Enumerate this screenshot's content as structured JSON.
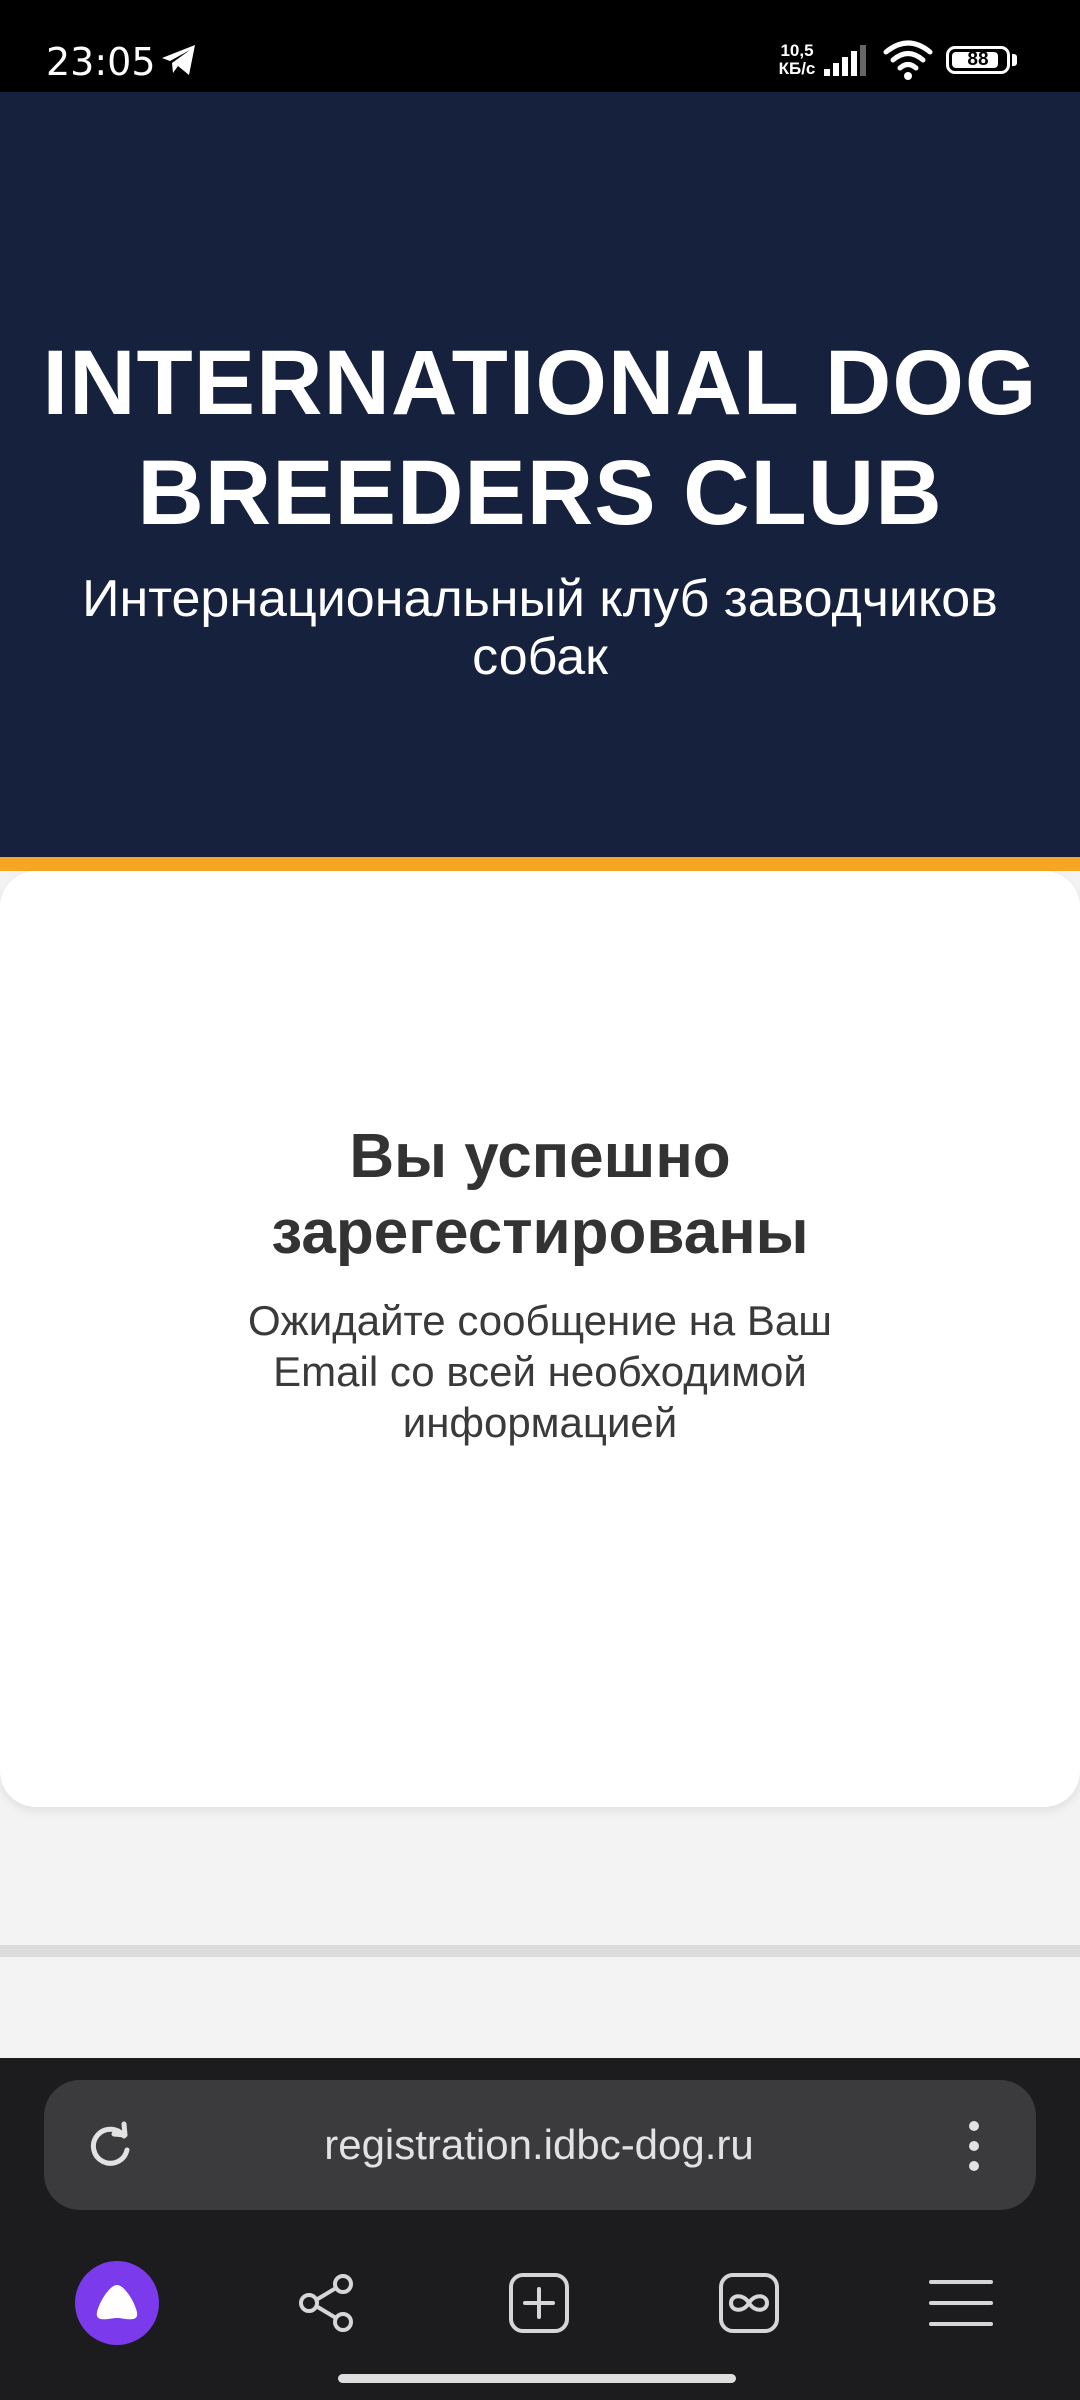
{
  "status_bar": {
    "time": "23:05",
    "net_speed_value": "10,5",
    "net_speed_unit": "КБ/с",
    "battery_level": "88",
    "icons": [
      "telegram-icon",
      "signal-icon",
      "wifi-icon",
      "battery-icon"
    ]
  },
  "hero": {
    "title": "INTERNATIONAL DOG BREEDERS CLUB",
    "subtitle": "Интернациональный клуб заводчиков собак",
    "background_color": "#15213d",
    "accent_color": "#f5a623"
  },
  "confirmation": {
    "heading": "Вы успешно зарегестированы",
    "message": "Ожидайте сообщение на Ваш Email со всей необходимой информацией"
  },
  "browser": {
    "url": "registration.idbc-dog.ru",
    "assistant_color": "#7c3aed",
    "nav_icons": [
      "alice-icon",
      "share-icon",
      "new-tab-icon",
      "tabs-icon",
      "menu-icon"
    ]
  }
}
